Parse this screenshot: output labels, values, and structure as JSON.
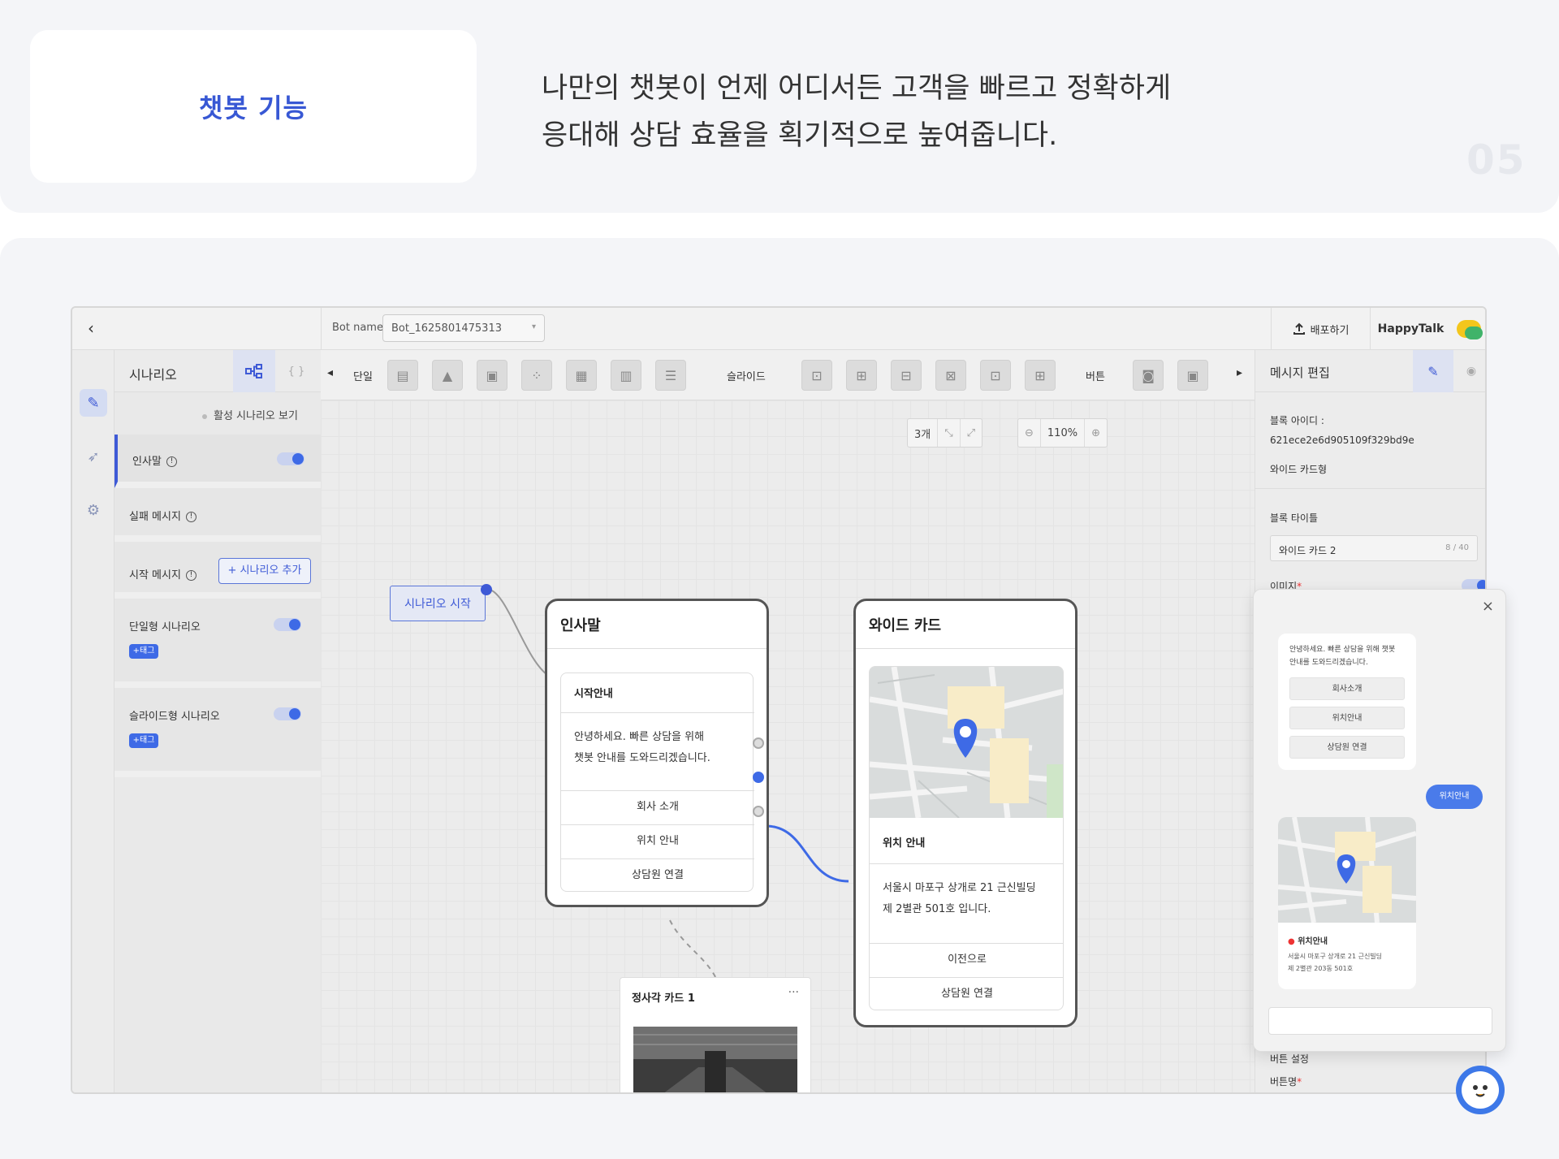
{
  "header": {
    "feature_title": "챗봇 기능",
    "description_line1": "나만의 챗봇이 언제 어디서든 고객을 빠르고 정확하게",
    "description_line2": "응대해 상담 효율을 획기적으로 높여줍니다.",
    "page_number": "05"
  },
  "topbar": {
    "back": "‹",
    "bot_name_label": "Bot name",
    "bot_name_value": "Bot_1625801475313",
    "deploy_label": "배포하기",
    "brand_name": "HappyTalk"
  },
  "scenario_panel": {
    "title": "시나리오",
    "tab_code": "{ }",
    "active_view": "활성 시나리오 보기",
    "items": [
      {
        "label": "인사말",
        "toggle": true
      },
      {
        "label": "실패 메시지"
      },
      {
        "label": "시작 메시지",
        "add_button": "+ 시나리오 추가"
      },
      {
        "label": "단일형 시나리오",
        "toggle": true,
        "tag": "+태그"
      },
      {
        "label": "슬라이드형 시나리오",
        "toggle": true,
        "tag": "+태그"
      }
    ]
  },
  "toolbar": {
    "single_label": "단일",
    "slide_label": "슬라이드",
    "button_label": "버튼"
  },
  "canvas": {
    "zoom": {
      "count": "3개",
      "level": "110%"
    },
    "scenario_start": "시나리오 시작",
    "greeting_node": {
      "title": "인사말",
      "card_title": "시작안내",
      "card_text_1": "안녕하세요. 빠른 상담을 위해",
      "card_text_2": "챗봇 안내를 도와드리겠습니다.",
      "buttons": [
        "회사 소개",
        "위치 안내",
        "상담원 연결"
      ]
    },
    "wide_node": {
      "title": "와이드 카드",
      "card_title": "위치 안내",
      "address_1": "서울시 마포구 상개로 21 근신빌딩",
      "address_2": "제 2별관 501호 입니다.",
      "buttons": [
        "이전으로",
        "상담원 연결"
      ]
    },
    "square_node": {
      "title": "정사각 카드 1",
      "menu": "···"
    }
  },
  "message_edit": {
    "title": "메시지 편집",
    "block_id_label": "블록 아이디 :",
    "block_id": "621ece2e6d905109f329bd9e",
    "block_type": "와이드 카드형",
    "block_title_label": "블록 타이틀",
    "block_title_value": "와이드 카드 2",
    "block_title_count": "8 / 40",
    "image_label": "이미지",
    "button_setting_label": "버튼 설정",
    "button_name_label": "버튼명"
  },
  "preview": {
    "close": "×",
    "bot_text_1": "안녕하세요. 빠른 상담을 위해 챗봇",
    "bot_text_2": "안내를 도와드리겠습니다.",
    "buttons": [
      "회사소개",
      "위치안내",
      "상담원 연결"
    ],
    "user_message": "위치안내",
    "map_title": "위치안내",
    "map_text_1": "서울시 마포구 상개로 21 근신빌딩",
    "map_text_2": "제 2별관 203동 501호"
  },
  "colors": {
    "accent": "#3e6ae6",
    "title_blue": "#3858d4",
    "brand_yellow": "#f3c61c",
    "brand_green": "#40b36a"
  }
}
